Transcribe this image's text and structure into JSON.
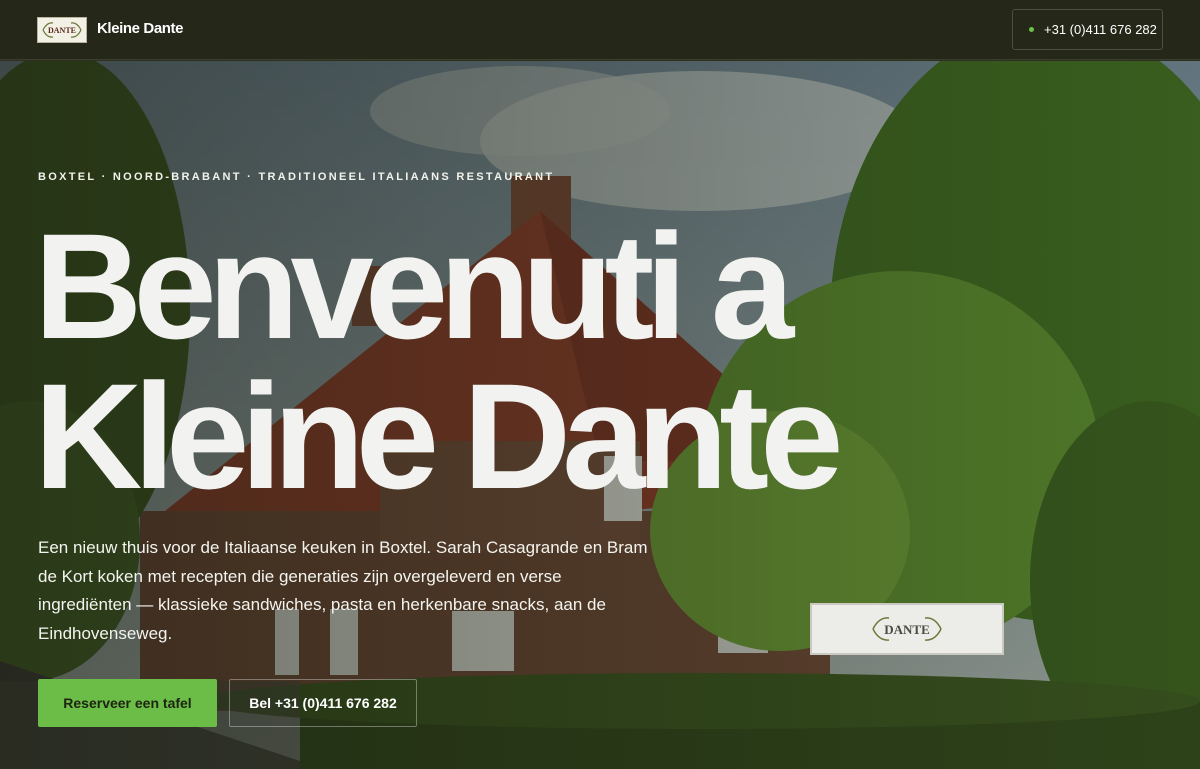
{
  "header": {
    "logo_text": "DANTE",
    "brand": "Kleine Dante",
    "phone": "+31 (0)411 676 282"
  },
  "hero": {
    "eyebrow": "BOXTEL · NOORD-BRABANT · TRADITIONEEL ITALIAANS RESTAURANT",
    "title_line1": "Benvenuti a",
    "title_line2": "Kleine Dante",
    "lead": "Een nieuw thuis voor de Italiaanse keuken in Boxtel. Sarah Casagrande en Bram de Kort koken met recepten die generaties zijn overgeleverd en verse ingrediënten — klassieke sandwiches, pasta en herkenbare snacks, aan de Eindhovenseweg.",
    "primary_cta": "Reserveer een tafel",
    "secondary_cta": "Bel +31 (0)411 676 282",
    "sign_text": "DANTE"
  },
  "colors": {
    "accent": "#6cbd48",
    "header_bg": "#252818",
    "status_dot": "#6cc24a"
  },
  "icons": {
    "status": "status-dot-icon",
    "logo": "laurel-logo-icon"
  }
}
